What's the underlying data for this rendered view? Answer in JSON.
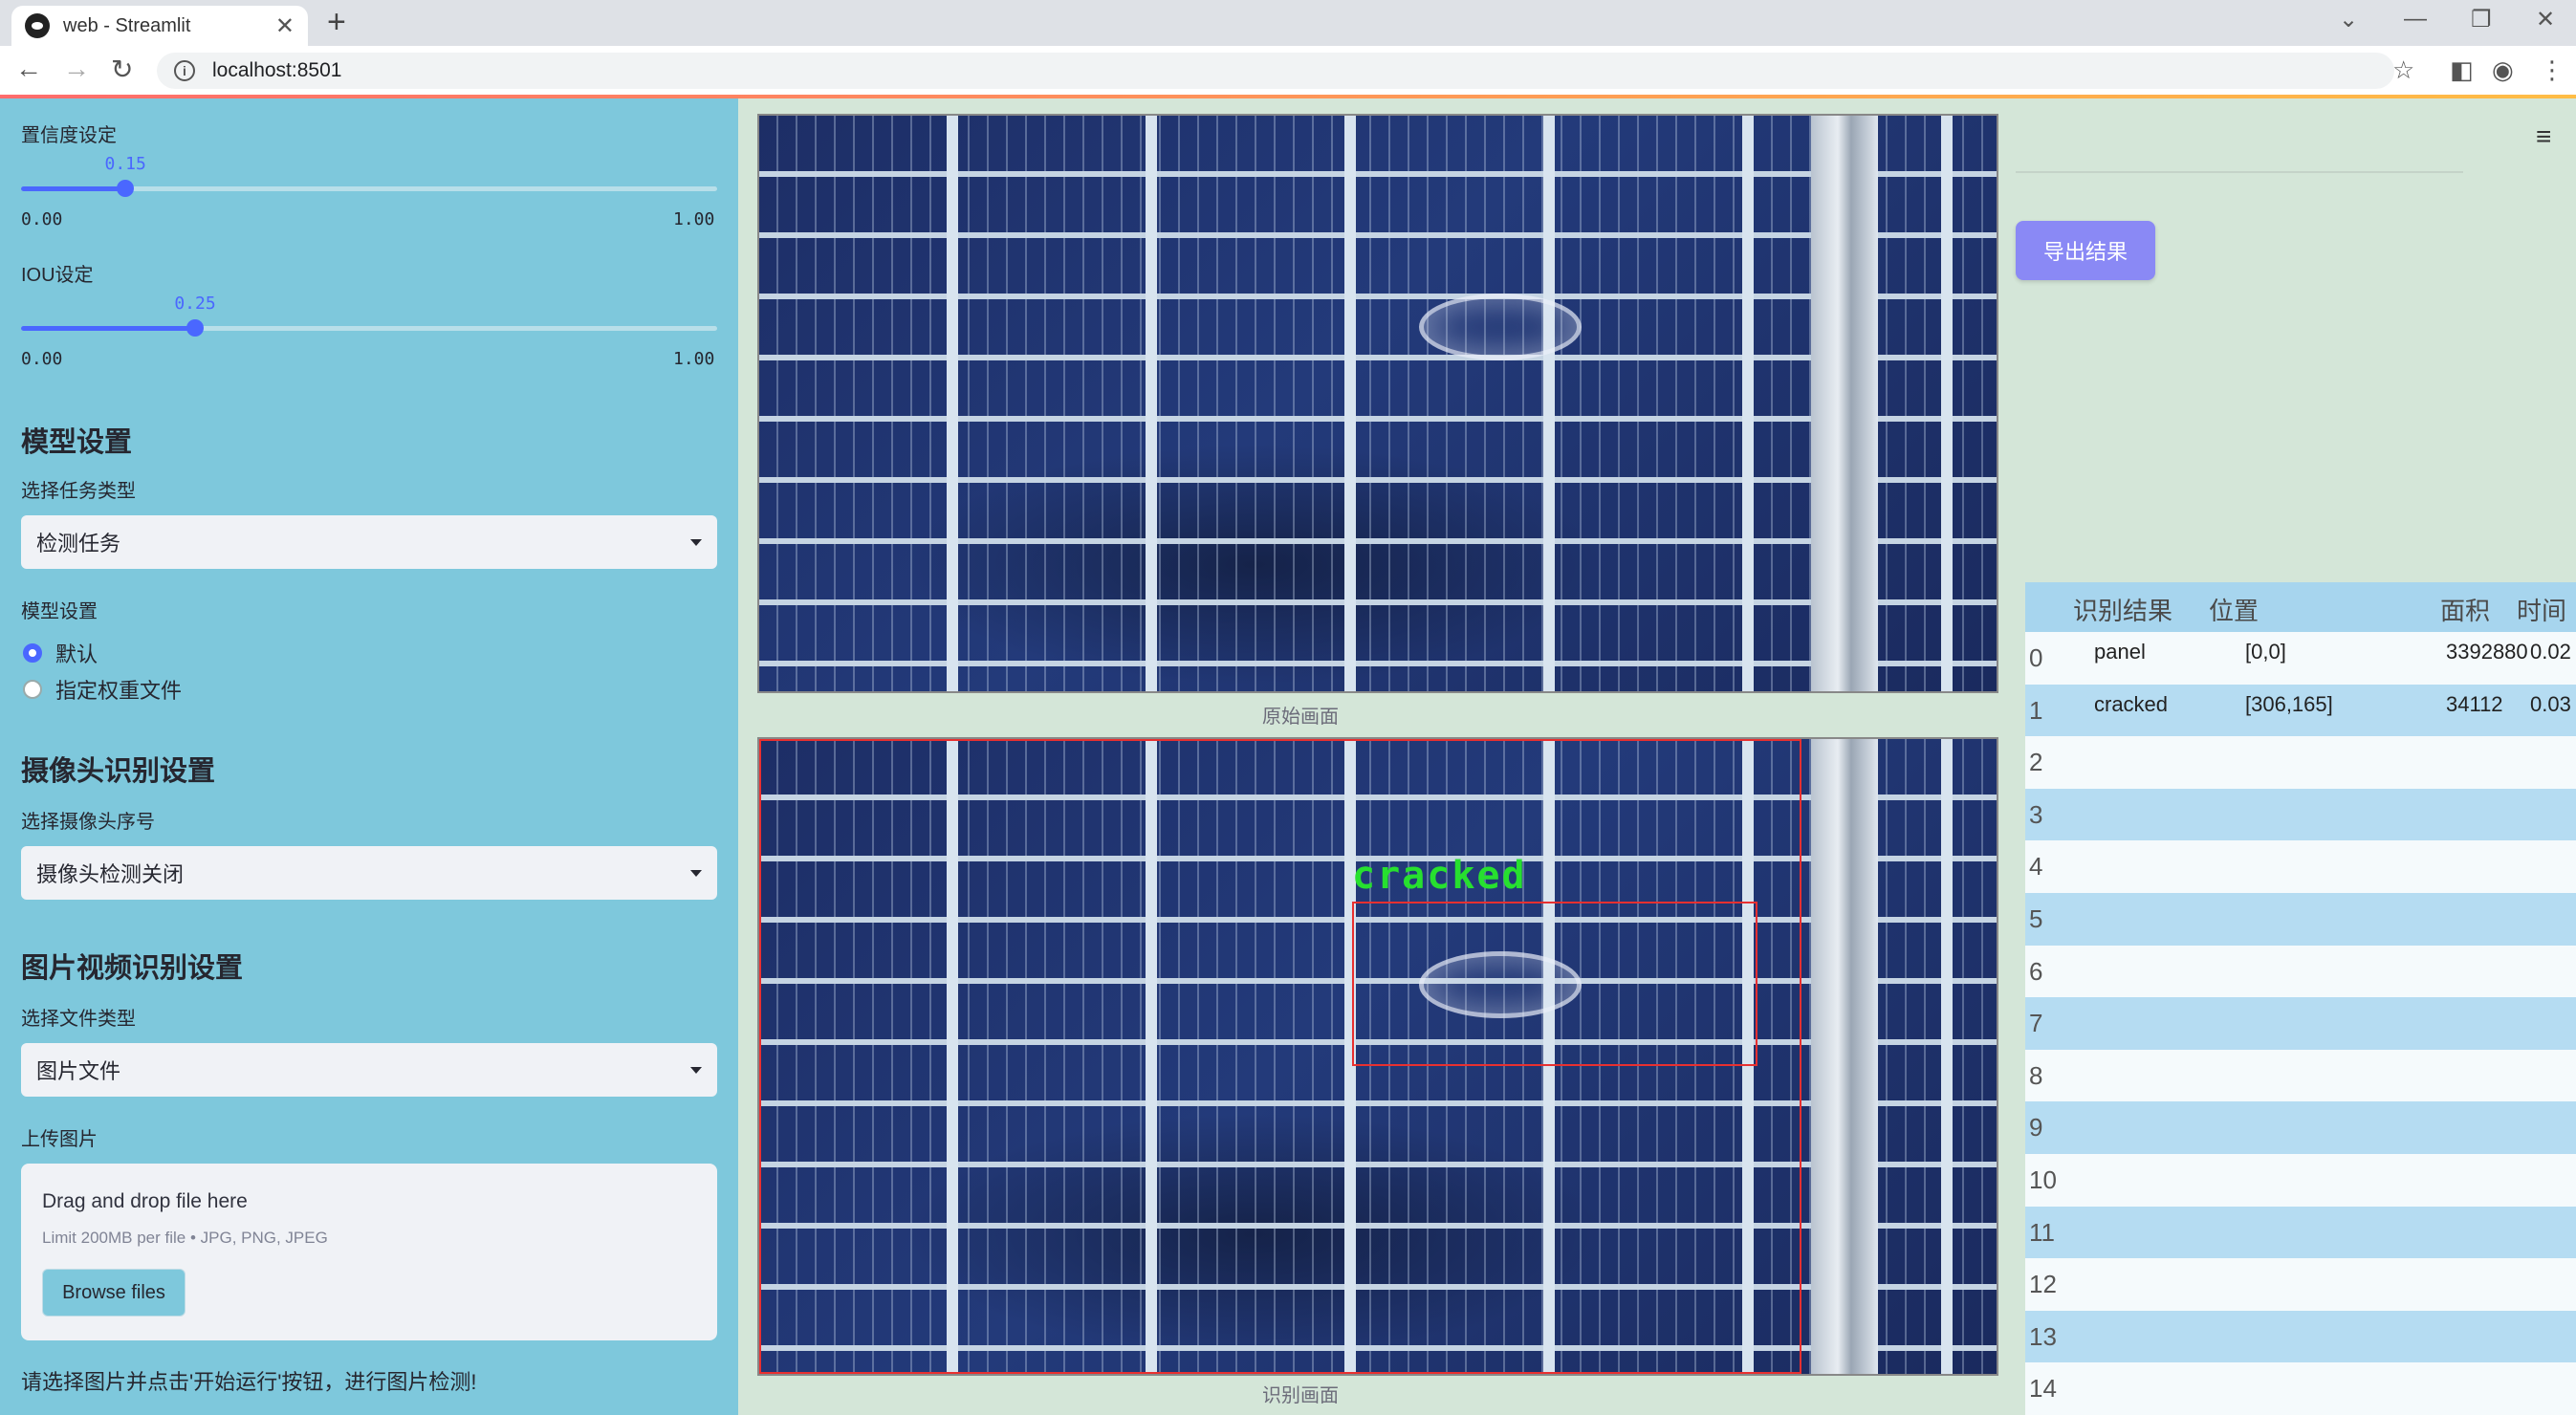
{
  "browser": {
    "tab_title": "web - Streamlit",
    "url": "localhost:8501"
  },
  "sidebar": {
    "confidence": {
      "label": "置信度设定",
      "value": 0.15,
      "value_text": "0.15",
      "min": "0.00",
      "max": "1.00"
    },
    "iou": {
      "label": "IOU设定",
      "value": 0.25,
      "value_text": "0.25",
      "min": "0.00",
      "max": "1.00"
    },
    "model_section": {
      "title": "模型设置",
      "task_label": "选择任务类型",
      "task_value": "检测任务",
      "model_label": "模型设置",
      "options": [
        "默认",
        "指定权重文件"
      ],
      "selected": 0
    },
    "camera_section": {
      "title": "摄像头识别设置",
      "camera_label": "选择摄像头序号",
      "camera_value": "摄像头检测关闭"
    },
    "file_section": {
      "title": "图片视频识别设置",
      "type_label": "选择文件类型",
      "type_value": "图片文件",
      "upload_label": "上传图片",
      "drop_text": "Drag and drop file here",
      "limit_text": "Limit 200MB per file • JPG, PNG, JPEG",
      "browse_label": "Browse files"
    },
    "hint": "请选择图片并点击'开始运行'按钮，进行图片检测!"
  },
  "main": {
    "original_caption": "原始画面",
    "detected_caption": "识别画面",
    "detection_label": "cracked",
    "export_label": "导出结果",
    "menu_icon": "hamburger-icon"
  },
  "table": {
    "headers": [
      "识别结果",
      "位置",
      "面积",
      "时间"
    ],
    "rows": [
      {
        "idx": "0",
        "label": "panel",
        "pos": "[0,0]",
        "area": "3392880",
        "time": "0.02"
      },
      {
        "idx": "1",
        "label": "cracked",
        "pos": "[306,165]",
        "area": "34112",
        "time": "0.03"
      },
      {
        "idx": "2"
      },
      {
        "idx": "3"
      },
      {
        "idx": "4"
      },
      {
        "idx": "5"
      },
      {
        "idx": "6"
      },
      {
        "idx": "7"
      },
      {
        "idx": "8"
      },
      {
        "idx": "9"
      },
      {
        "idx": "10"
      },
      {
        "idx": "11"
      },
      {
        "idx": "12"
      },
      {
        "idx": "13"
      },
      {
        "idx": "14"
      }
    ]
  },
  "colors": {
    "sidebar": "#7ec8dc",
    "main": "#d4e6d8",
    "accent": "#4a67ff",
    "export": "#8a89f5",
    "box": "#e83030",
    "label": "#27e02f"
  }
}
